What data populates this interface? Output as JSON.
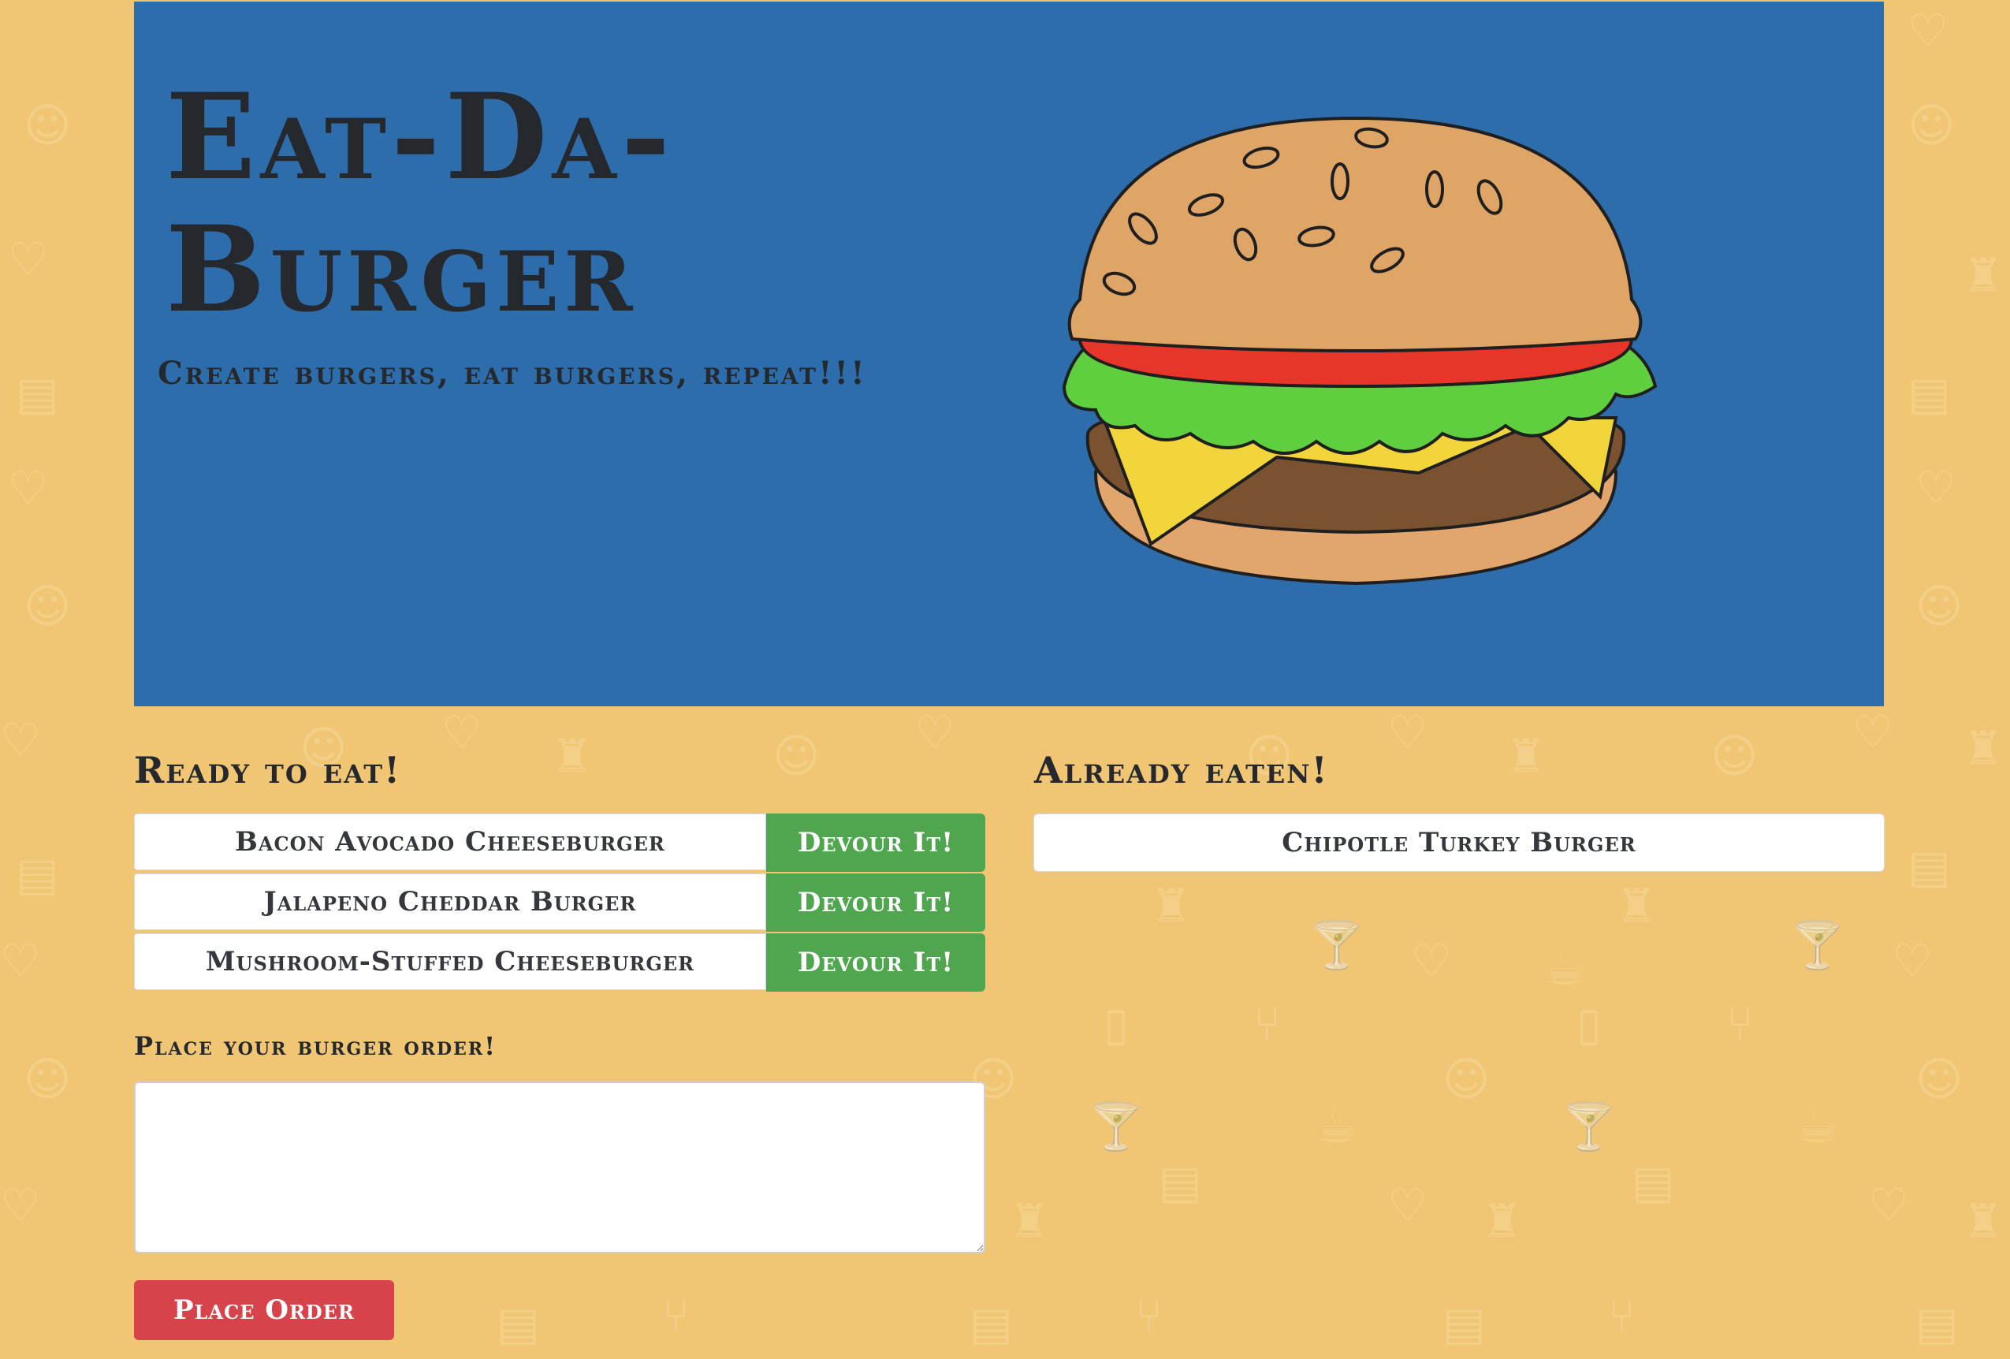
{
  "header": {
    "title": "Eat-Da-Burger",
    "tagline": "Create burgers, eat burgers, repeat!!!"
  },
  "ready": {
    "heading": "Ready to eat!",
    "items": [
      {
        "name": "Bacon Avocado Cheeseburger",
        "button": "Devour It!"
      },
      {
        "name": "Jalapeno Cheddar Burger",
        "button": "Devour It!"
      },
      {
        "name": "Mushroom-Stuffed Cheeseburger",
        "button": "Devour It!"
      }
    ]
  },
  "eaten": {
    "heading": "Already eaten!",
    "items": [
      {
        "name": "Chipotle Turkey Burger"
      }
    ]
  },
  "order_form": {
    "label": "Place your burger order!",
    "value": "",
    "placeholder": "",
    "submit_label": "Place Order"
  },
  "colors": {
    "page_background": "#f0c674",
    "header_background": "#2e6dab",
    "devour_button": "#4fa64f",
    "place_order_button": "#d7434b",
    "text_dark": "#25282c"
  },
  "icons": {
    "background_pattern": [
      "smiley-icon",
      "heart-icon",
      "chef-hat-icon",
      "sandwich-icon",
      "cocktail-icon",
      "fork-knife-icon",
      "teapot-icon",
      "popsicle-icon"
    ],
    "hero_image": "burger-icon"
  }
}
